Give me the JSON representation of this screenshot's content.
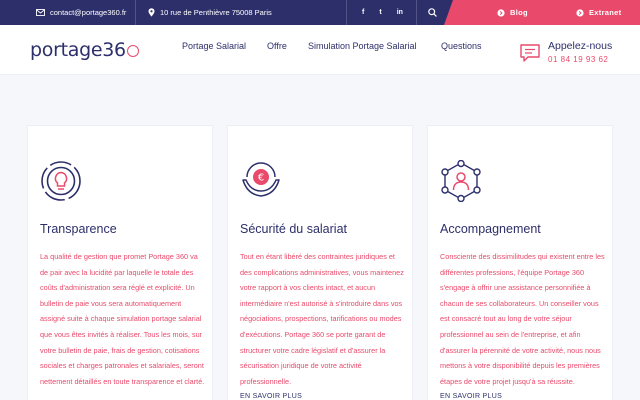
{
  "topbar": {
    "email": "contact@portage360.fr",
    "address": "10 rue de Penthièvre 75008 Paris",
    "social": [
      {
        "icon": "facebook-icon",
        "glyph": "f"
      },
      {
        "icon": "twitter-icon",
        "glyph": "t"
      },
      {
        "icon": "linkedin-icon",
        "glyph": "in"
      }
    ],
    "blog_label": "Blog",
    "extranet_label": "Extranet",
    "accent_color": "#e94a6b",
    "bar_color": "#2d2f6b"
  },
  "header": {
    "logo_text": "portage36",
    "nav": [
      "Portage Salarial",
      "Offre",
      "Simulation Portage Salarial",
      "Questions"
    ],
    "call_title": "Appelez-nous",
    "call_phone": "01 84 19 93 62"
  },
  "cards": [
    {
      "icon": "lightbulb-target-icon",
      "title": "Transparence",
      "description": "La qualité de gestion que promet Portage 360 va de pair avec la lucidité par laquelle le totale des coûts d'administration sera réglé et explicité. Un bulletin de paie vous sera automatiquement assigné suite à chaque simulation portage salarial que vous êtes invités à réaliser. Tous les mois, sur votre bulletin de paie, frais de gestion, cotisations sociales et charges patronales et salariales, seront nettement détaillés en toute transparence et clarté.",
      "more": ""
    },
    {
      "icon": "euro-hands-icon",
      "title": "Sécurité du salariat",
      "description": "Tout en étant libéré des contraintes juridiques et des complications administratives, vous maintenez votre rapport à vos clients intact, et aucun intermédiaire n'est autorisé à s'introduire dans vos négociations, prospections, tarifications ou modes d'exécutions. Portage 360 se porte garant de structurer votre cadre législatif et d'assurer la sécurisation juridique de votre activité professionnelle.",
      "more": "EN SAVOIR PLUS"
    },
    {
      "icon": "network-person-icon",
      "title": "Accompagnement",
      "description": "Consciente des dissimilitudes qui existent entre les différentes professions, l'équipe Portage 360 s'engage à offrir une assistance personnifiée à chacun de ses collaborateurs. Un conseiller vous est consacré tout au long de votre séjour professionnel au sein de l'entreprise, et afin d'assurer la pérennité de votre activité, nous nous mettons à votre disponibilité depuis les premières étapes de votre projet jusqu'à sa réussite.",
      "more": "EN SAVOIR PLUS"
    }
  ]
}
